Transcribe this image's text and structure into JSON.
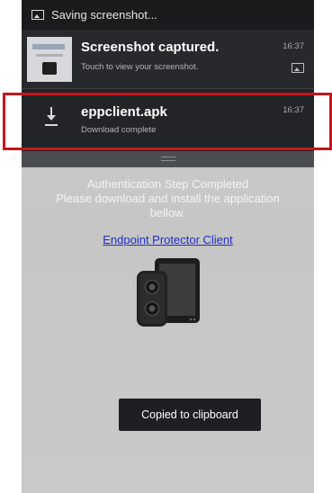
{
  "status_bar": {
    "text": "Saving screenshot...",
    "icon": "image-icon"
  },
  "notifications": [
    {
      "title": "Screenshot captured.",
      "subtitle": "Touch to view your screenshot.",
      "time": "16:37",
      "icon": "screenshot-thumbnail",
      "action_icon": "image-icon"
    },
    {
      "title": "eppclient.apk",
      "subtitle": "Download complete",
      "time": "16:37",
      "icon": "download-icon"
    }
  ],
  "page": {
    "lines": [
      "Authentication Step Completed",
      "Please download and install the application",
      "bellow."
    ],
    "link": "Endpoint Protector Client",
    "device_icon": "device-illustration"
  },
  "toast": {
    "text": "Copied to clipboard"
  },
  "colors": {
    "highlight_box": "#c8141c",
    "link": "#1e2cc8",
    "shade_background": "#27292c"
  }
}
